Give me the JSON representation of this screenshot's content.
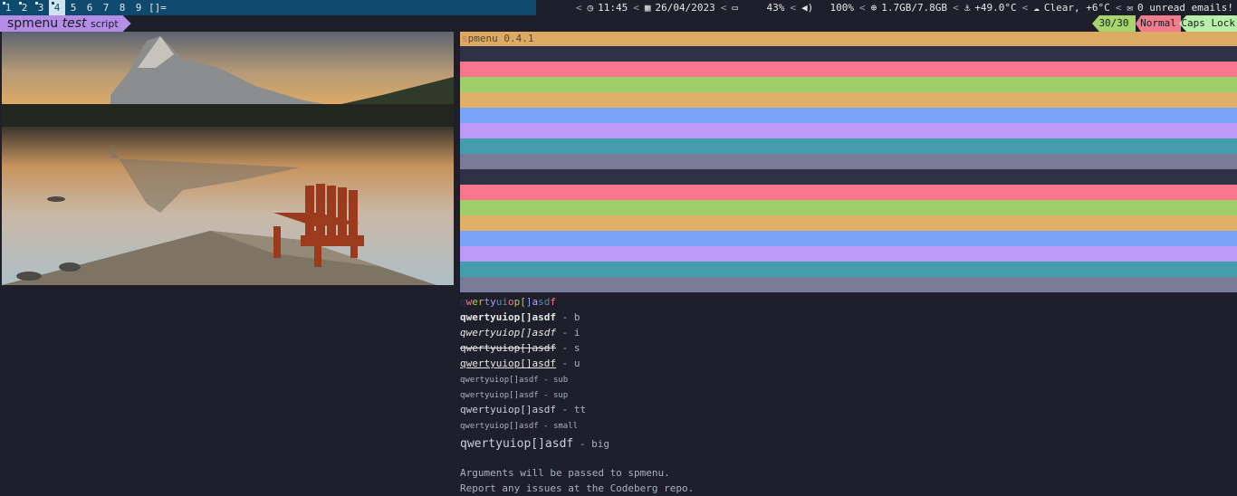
{
  "topbar": {
    "workspaces": [
      "1",
      "2",
      "3",
      "4",
      "5",
      "6",
      "7",
      "8",
      "9"
    ],
    "active_workspace_index": 3,
    "occupied_workspace_indices": [
      0,
      1,
      2,
      3
    ],
    "layout_symbol": "[]=",
    "status": {
      "time": "11:45",
      "date": "26/04/2023",
      "battery": "43%",
      "volume": "100%",
      "memory": "1.7GB/7.8GB",
      "temperature": "+49.0°C",
      "weather": "Clear, +6°C",
      "mail": "0 unread emails!"
    }
  },
  "prompt": {
    "word1": "spmenu",
    "word2": "test",
    "word3": "script"
  },
  "indicators": {
    "counter": "30/30",
    "mode": "Normal",
    "caps_lock": "Caps Lock"
  },
  "panel": {
    "version_cursor": "s",
    "version_text": "pmenu 0.4.1",
    "stripe_colors": [
      "#2f3147",
      "#f7768e",
      "#9ece6a",
      "#e0af68",
      "#7aa2f7",
      "#bb9af7",
      "#449dab",
      "#787c99",
      "#2f3147",
      "#f7768e",
      "#9ece6a",
      "#e0af68",
      "#7aa2f7",
      "#bb9af7",
      "#449dab",
      "#787c99"
    ],
    "color_text_line": {
      "chars": [
        "q",
        "w",
        "e",
        "r",
        "t",
        "y",
        "u",
        "i",
        "o",
        "p",
        "[",
        "]",
        "a",
        "s",
        "d",
        "f"
      ],
      "colors": [
        "#2f3147",
        "#f7768e",
        "#9ece6a",
        "#e0af68",
        "#7aa2f7",
        "#bb9af7",
        "#449dab",
        "#787c99",
        "#f7768e",
        "#9ece6a",
        "#e0af68",
        "#7aa2f7",
        "#bb9af7",
        "#449dab",
        "#787c99",
        "#f7768e"
      ]
    },
    "sample_word": "qwertyuiop[]asdf",
    "style_lines": [
      {
        "style": "b",
        "suffix": " - b"
      },
      {
        "style": "i",
        "suffix": " - i"
      },
      {
        "style": "s",
        "suffix": " - s"
      },
      {
        "style": "u",
        "suffix": " - u"
      },
      {
        "style": "sub",
        "suffix": " - sub"
      },
      {
        "style": "sup",
        "suffix": " - sup"
      },
      {
        "style": "tt",
        "suffix": " - tt"
      },
      {
        "style": "small",
        "suffix": " - small"
      },
      {
        "style": "big",
        "suffix": " - big"
      }
    ],
    "message_lines": [
      "Arguments will be passed to spmenu.",
      "Report any issues at the Codeberg repo."
    ]
  }
}
